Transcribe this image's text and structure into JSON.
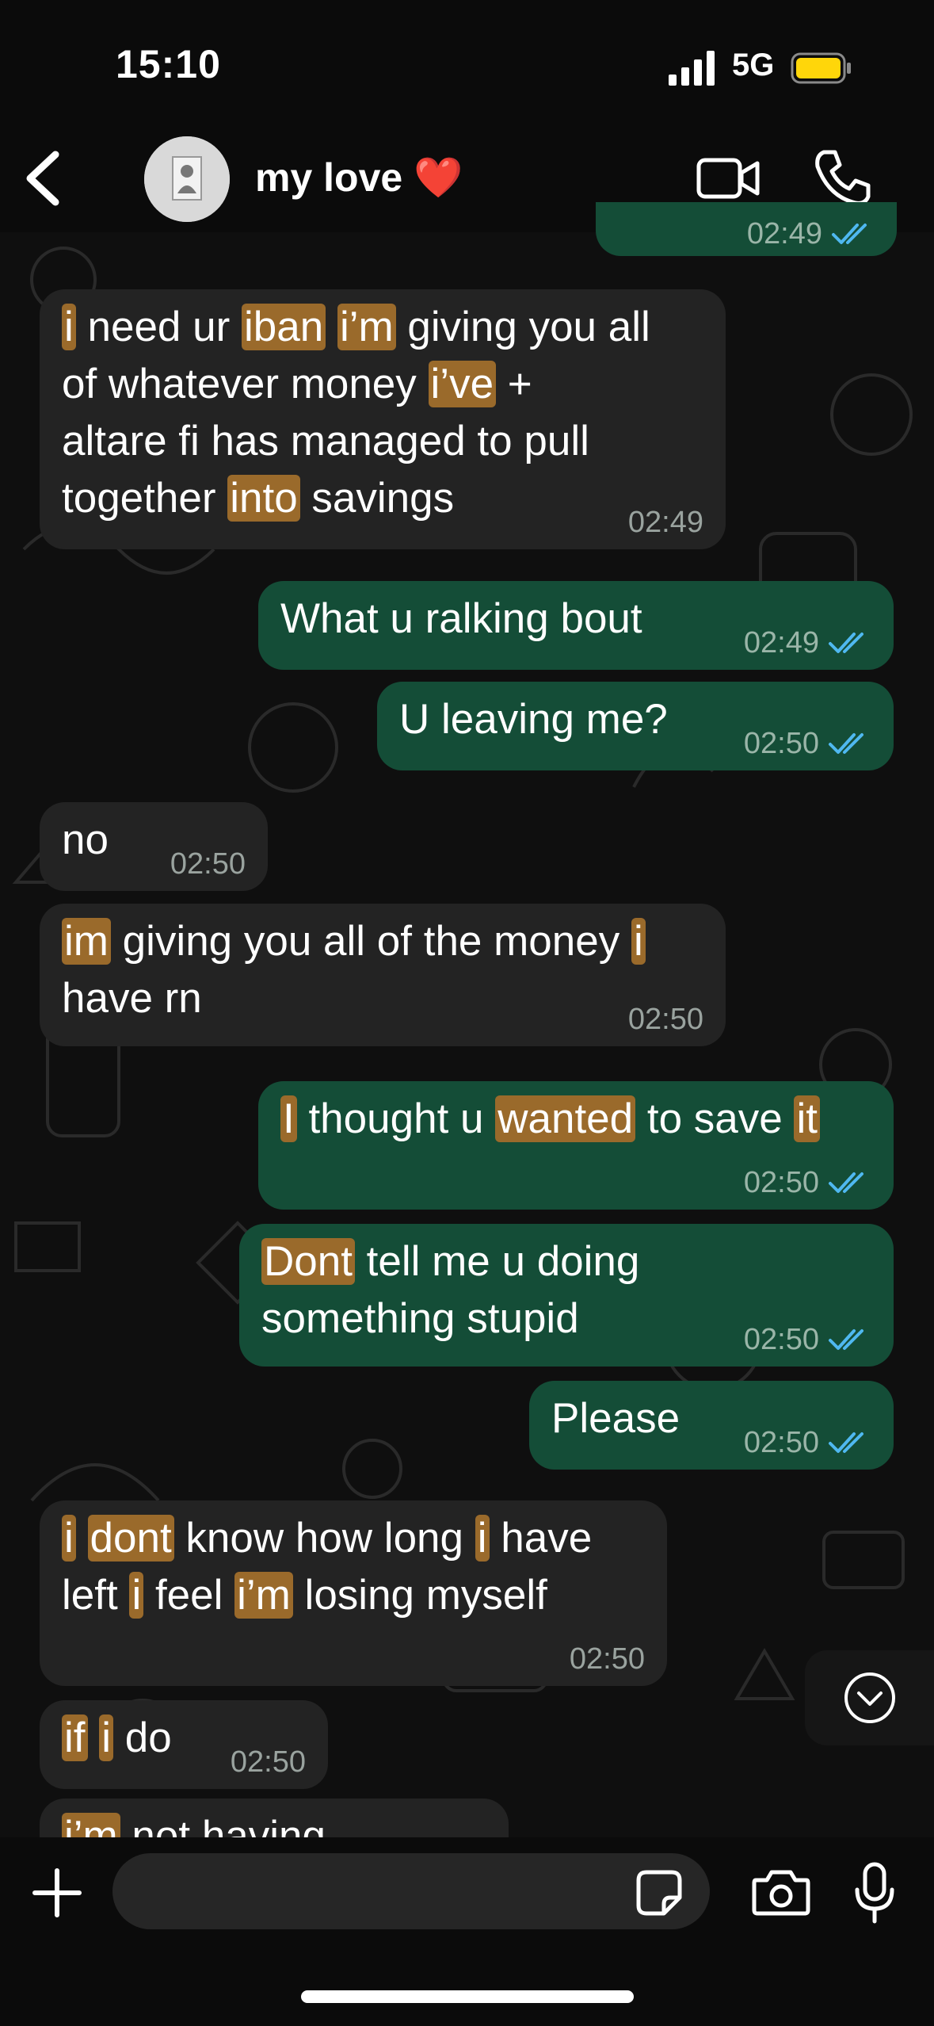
{
  "status": {
    "time": "15:10",
    "network": "5G"
  },
  "header": {
    "contact_name": "my love",
    "emoji": "❤️"
  },
  "colors": {
    "incoming": "#232323",
    "outgoing": "#144d37",
    "highlight": "#9a6a2b",
    "read_tick": "#4fb8f0"
  },
  "messages": [
    {
      "dir": "out",
      "time": "02:49",
      "partial": true
    },
    {
      "dir": "in",
      "time": "02:49",
      "lines": [
        [
          {
            "t": "i",
            "h": true
          },
          {
            "t": " need ur "
          },
          {
            "t": "iban",
            "h": true
          },
          {
            "t": " "
          },
          {
            "t": "i’m",
            "h": true
          },
          {
            "t": " giving you all"
          }
        ],
        [
          {
            "t": "of whatever money "
          },
          {
            "t": "i’ve",
            "h": true
          },
          {
            "t": " +"
          }
        ],
        [
          {
            "t": "altare fi has managed to pull"
          }
        ],
        [
          {
            "t": "together "
          },
          {
            "t": "into",
            "h": true
          },
          {
            "t": " savings"
          }
        ]
      ]
    },
    {
      "dir": "out",
      "time": "02:49",
      "lines": [
        [
          {
            "t": "What u ralking bout"
          }
        ]
      ]
    },
    {
      "dir": "out",
      "time": "02:50",
      "lines": [
        [
          {
            "t": "U leaving me?"
          }
        ]
      ]
    },
    {
      "dir": "in",
      "time": "02:50",
      "lines": [
        [
          {
            "t": "no"
          }
        ]
      ]
    },
    {
      "dir": "in",
      "time": "02:50",
      "lines": [
        [
          {
            "t": "im",
            "h": true
          },
          {
            "t": " giving you all of the money "
          },
          {
            "t": "i",
            "h": true
          }
        ],
        [
          {
            "t": "have rn"
          }
        ]
      ]
    },
    {
      "dir": "out",
      "time": "02:50",
      "lines": [
        [
          {
            "t": "I",
            "h": true
          },
          {
            "t": " thought u "
          },
          {
            "t": "wanted",
            "h": true
          },
          {
            "t": " to save "
          },
          {
            "t": "it",
            "h": true
          }
        ]
      ]
    },
    {
      "dir": "out",
      "time": "02:50",
      "lines": [
        [
          {
            "t": "Dont",
            "h": true
          },
          {
            "t": " tell me u doing"
          }
        ],
        [
          {
            "t": "something stupid"
          }
        ]
      ]
    },
    {
      "dir": "out",
      "time": "02:50",
      "lines": [
        [
          {
            "t": "Please"
          }
        ]
      ]
    },
    {
      "dir": "in",
      "time": "02:50",
      "lines": [
        [
          {
            "t": "i",
            "h": true
          },
          {
            "t": " "
          },
          {
            "t": "dont",
            "h": true
          },
          {
            "t": " know how long "
          },
          {
            "t": "i",
            "h": true
          },
          {
            "t": " have"
          }
        ],
        [
          {
            "t": "left "
          },
          {
            "t": "i",
            "h": true
          },
          {
            "t": " feel "
          },
          {
            "t": "i’m",
            "h": true
          },
          {
            "t": " losing myself"
          }
        ]
      ]
    },
    {
      "dir": "in",
      "time": "02:50",
      "lines": [
        [
          {
            "t": "if",
            "h": true
          },
          {
            "t": " "
          },
          {
            "t": "i",
            "h": true
          },
          {
            "t": " do"
          }
        ]
      ]
    },
    {
      "dir": "in",
      "time": "",
      "partial": true,
      "lines": [
        [
          {
            "t": "i’m",
            "h": true
          },
          {
            "t": " not having"
          }
        ]
      ]
    }
  ],
  "composer": {
    "placeholder": ""
  },
  "icons": [
    "back-chevron-icon",
    "video-call-icon",
    "phone-icon",
    "plus-icon",
    "sticker-icon",
    "camera-icon",
    "microphone-icon",
    "chevron-down-icon",
    "double-tick-icon"
  ]
}
